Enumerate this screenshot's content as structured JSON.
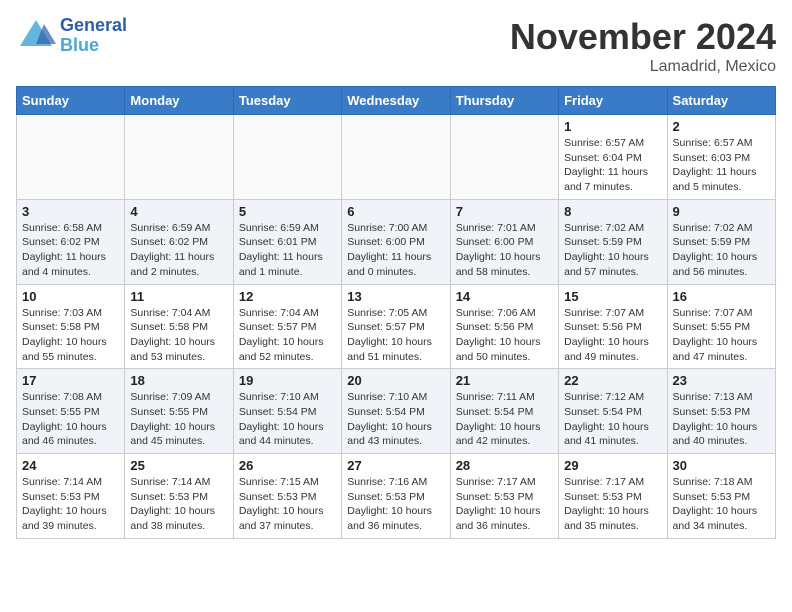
{
  "header": {
    "logo_general": "General",
    "logo_blue": "Blue",
    "month_title": "November 2024",
    "location": "Lamadrid, Mexico"
  },
  "days_of_week": [
    "Sunday",
    "Monday",
    "Tuesday",
    "Wednesday",
    "Thursday",
    "Friday",
    "Saturday"
  ],
  "weeks": [
    [
      {
        "day": "",
        "detail": ""
      },
      {
        "day": "",
        "detail": ""
      },
      {
        "day": "",
        "detail": ""
      },
      {
        "day": "",
        "detail": ""
      },
      {
        "day": "",
        "detail": ""
      },
      {
        "day": "1",
        "detail": "Sunrise: 6:57 AM\nSunset: 6:04 PM\nDaylight: 11 hours and 7 minutes."
      },
      {
        "day": "2",
        "detail": "Sunrise: 6:57 AM\nSunset: 6:03 PM\nDaylight: 11 hours and 5 minutes."
      }
    ],
    [
      {
        "day": "3",
        "detail": "Sunrise: 6:58 AM\nSunset: 6:02 PM\nDaylight: 11 hours and 4 minutes."
      },
      {
        "day": "4",
        "detail": "Sunrise: 6:59 AM\nSunset: 6:02 PM\nDaylight: 11 hours and 2 minutes."
      },
      {
        "day": "5",
        "detail": "Sunrise: 6:59 AM\nSunset: 6:01 PM\nDaylight: 11 hours and 1 minute."
      },
      {
        "day": "6",
        "detail": "Sunrise: 7:00 AM\nSunset: 6:00 PM\nDaylight: 11 hours and 0 minutes."
      },
      {
        "day": "7",
        "detail": "Sunrise: 7:01 AM\nSunset: 6:00 PM\nDaylight: 10 hours and 58 minutes."
      },
      {
        "day": "8",
        "detail": "Sunrise: 7:02 AM\nSunset: 5:59 PM\nDaylight: 10 hours and 57 minutes."
      },
      {
        "day": "9",
        "detail": "Sunrise: 7:02 AM\nSunset: 5:59 PM\nDaylight: 10 hours and 56 minutes."
      }
    ],
    [
      {
        "day": "10",
        "detail": "Sunrise: 7:03 AM\nSunset: 5:58 PM\nDaylight: 10 hours and 55 minutes."
      },
      {
        "day": "11",
        "detail": "Sunrise: 7:04 AM\nSunset: 5:58 PM\nDaylight: 10 hours and 53 minutes."
      },
      {
        "day": "12",
        "detail": "Sunrise: 7:04 AM\nSunset: 5:57 PM\nDaylight: 10 hours and 52 minutes."
      },
      {
        "day": "13",
        "detail": "Sunrise: 7:05 AM\nSunset: 5:57 PM\nDaylight: 10 hours and 51 minutes."
      },
      {
        "day": "14",
        "detail": "Sunrise: 7:06 AM\nSunset: 5:56 PM\nDaylight: 10 hours and 50 minutes."
      },
      {
        "day": "15",
        "detail": "Sunrise: 7:07 AM\nSunset: 5:56 PM\nDaylight: 10 hours and 49 minutes."
      },
      {
        "day": "16",
        "detail": "Sunrise: 7:07 AM\nSunset: 5:55 PM\nDaylight: 10 hours and 47 minutes."
      }
    ],
    [
      {
        "day": "17",
        "detail": "Sunrise: 7:08 AM\nSunset: 5:55 PM\nDaylight: 10 hours and 46 minutes."
      },
      {
        "day": "18",
        "detail": "Sunrise: 7:09 AM\nSunset: 5:55 PM\nDaylight: 10 hours and 45 minutes."
      },
      {
        "day": "19",
        "detail": "Sunrise: 7:10 AM\nSunset: 5:54 PM\nDaylight: 10 hours and 44 minutes."
      },
      {
        "day": "20",
        "detail": "Sunrise: 7:10 AM\nSunset: 5:54 PM\nDaylight: 10 hours and 43 minutes."
      },
      {
        "day": "21",
        "detail": "Sunrise: 7:11 AM\nSunset: 5:54 PM\nDaylight: 10 hours and 42 minutes."
      },
      {
        "day": "22",
        "detail": "Sunrise: 7:12 AM\nSunset: 5:54 PM\nDaylight: 10 hours and 41 minutes."
      },
      {
        "day": "23",
        "detail": "Sunrise: 7:13 AM\nSunset: 5:53 PM\nDaylight: 10 hours and 40 minutes."
      }
    ],
    [
      {
        "day": "24",
        "detail": "Sunrise: 7:14 AM\nSunset: 5:53 PM\nDaylight: 10 hours and 39 minutes."
      },
      {
        "day": "25",
        "detail": "Sunrise: 7:14 AM\nSunset: 5:53 PM\nDaylight: 10 hours and 38 minutes."
      },
      {
        "day": "26",
        "detail": "Sunrise: 7:15 AM\nSunset: 5:53 PM\nDaylight: 10 hours and 37 minutes."
      },
      {
        "day": "27",
        "detail": "Sunrise: 7:16 AM\nSunset: 5:53 PM\nDaylight: 10 hours and 36 minutes."
      },
      {
        "day": "28",
        "detail": "Sunrise: 7:17 AM\nSunset: 5:53 PM\nDaylight: 10 hours and 36 minutes."
      },
      {
        "day": "29",
        "detail": "Sunrise: 7:17 AM\nSunset: 5:53 PM\nDaylight: 10 hours and 35 minutes."
      },
      {
        "day": "30",
        "detail": "Sunrise: 7:18 AM\nSunset: 5:53 PM\nDaylight: 10 hours and 34 minutes."
      }
    ]
  ]
}
